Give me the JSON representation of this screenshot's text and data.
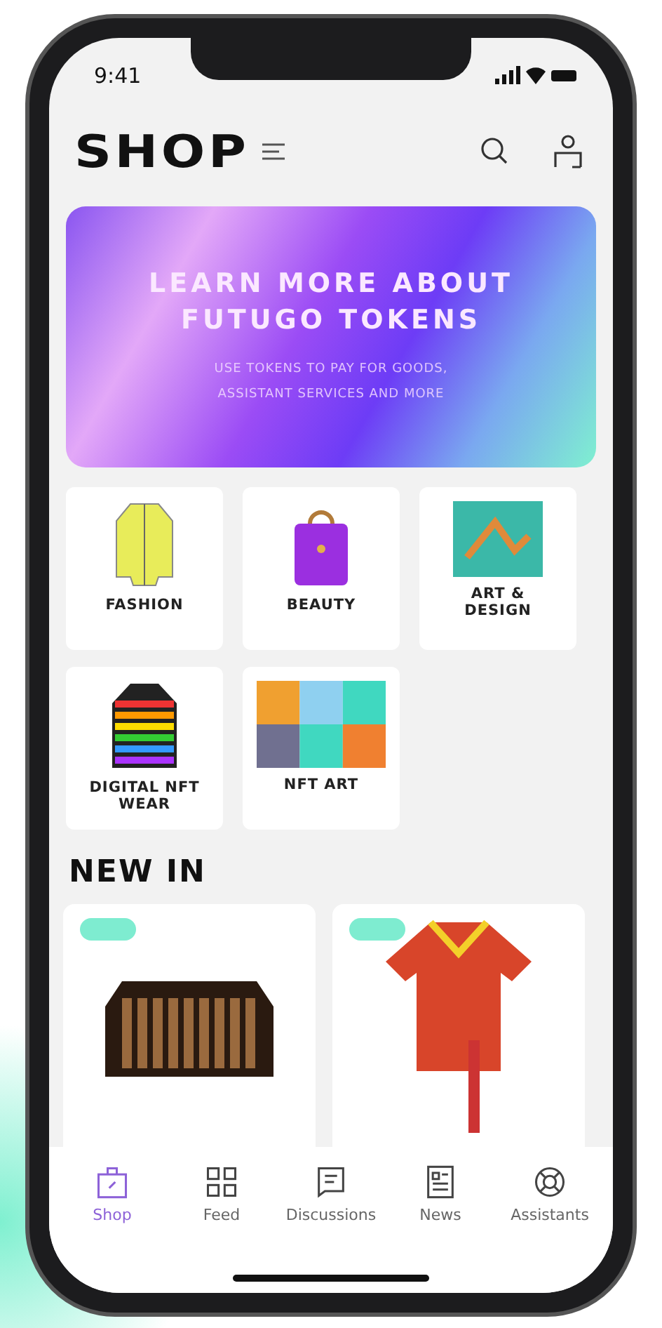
{
  "status_bar": {
    "time": "9:41"
  },
  "header": {
    "title": "SHOP"
  },
  "banner": {
    "title": "LEARN MORE ABOUT FUTUGO TOKENS",
    "subtitle": "USE TOKENS TO PAY FOR GOODS, ASSISTANT SERVICES AND MORE"
  },
  "categories": [
    {
      "label": "FASHION",
      "kind": "jacket"
    },
    {
      "label": "BEAUTY",
      "kind": "bag"
    },
    {
      "label": "ART & DESIGN",
      "kind": "painting"
    },
    {
      "label": "DIGITAL NFT WEAR",
      "kind": "puffer"
    },
    {
      "label": "NFT ART",
      "kind": "grid"
    }
  ],
  "new_in": {
    "title": "NEW IN",
    "products": [
      {
        "kind": "clutch",
        "badge": true
      },
      {
        "kind": "shirt",
        "badge": true
      }
    ]
  },
  "nav": [
    {
      "label": "Shop",
      "kind": "bag",
      "selected": true
    },
    {
      "label": "Feed",
      "kind": "grid",
      "selected": false
    },
    {
      "label": "Discussions",
      "kind": "chat",
      "selected": false
    },
    {
      "label": "News",
      "kind": "news",
      "selected": false
    },
    {
      "label": "Assistants",
      "kind": "lifebuoy",
      "selected": false
    }
  ]
}
